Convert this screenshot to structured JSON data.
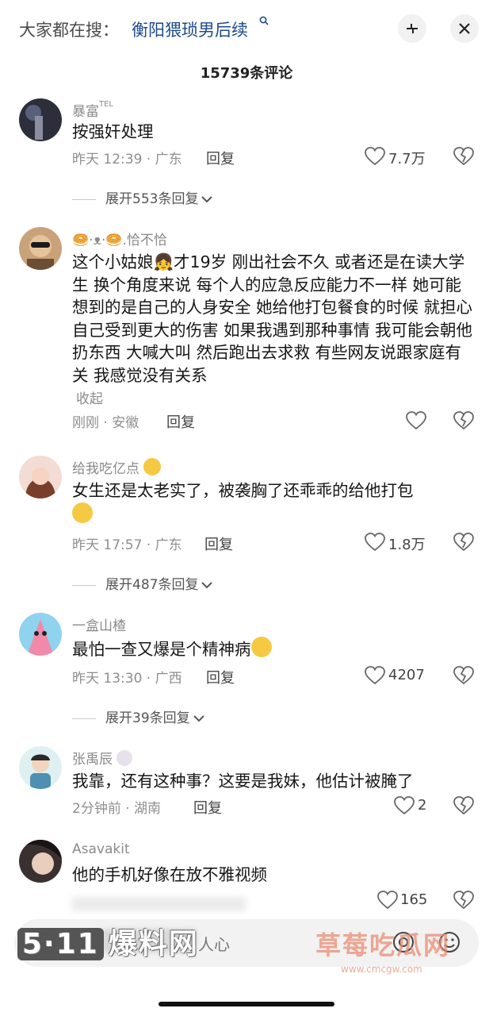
{
  "header": {
    "search_prefix": "大家都在搜：",
    "search_query": "衡阳猥琐男后续",
    "search_query_icon": "search-mini-icon",
    "comment_count": "15739条评论"
  },
  "comments": [
    {
      "username": "暴富",
      "username_tag": "TEL",
      "text": "按强奸处理",
      "time_location": "昨天 12:39 · 广东",
      "reply_label": "回复",
      "like_count": "7.7万",
      "expand_label": "展开553条回复"
    },
    {
      "username": "🥯·ᴥ·🥯.恰不恰",
      "text": "这个小姑娘👧才19岁  刚出社会不久  或者还是在读大学生   换个角度来说  每个人的应急反应能力不一样  她可能想到的是自己的人身安全  她给他打包餐食的时候  就担心自己受到更大的伤害   如果我遇到那种事情  我可能会朝他扔东西  大喊大叫  然后跑出去求救  有些网友说跟家庭有关  我感觉没有关系",
      "collapse_label": "收起",
      "time_location": "刚刚 · 安徽",
      "reply_label": "回复"
    },
    {
      "username": "给我吃亿点",
      "text": "女生还是太老实了，被袭胸了还乖乖的给他打包",
      "time_location": "昨天 17:57 · 广东",
      "reply_label": "回复",
      "like_count": "1.8万",
      "expand_label": "展开487条回复"
    },
    {
      "username": "一盒山楂",
      "text": "最怕一查又爆是个精神病",
      "time_location": "昨天 13:30 · 广西",
      "reply_label": "回复",
      "like_count": "4207",
      "expand_label": "展开39条回复"
    },
    {
      "username": "张禹辰",
      "text": "我靠，还有这种事？这要是我妹，他估计被腌了",
      "time_location": "2分钟前 · 湖南",
      "reply_label": "回复",
      "like_count": "2"
    },
    {
      "username": "Asavakit",
      "text": "他的手机好像在放不雅视频",
      "like_count": "165"
    }
  ],
  "bottom_bar": {
    "input_text": "人心"
  },
  "watermarks": {
    "left_number": "5·11",
    "left_text": "爆料网",
    "right_text": "草莓吃瓜网",
    "right_url": "www.cmcgw.com"
  },
  "colors": {
    "search_query": "#1e4a8c",
    "secondary_text": "#8a8a8a",
    "primary_text": "#161616"
  }
}
